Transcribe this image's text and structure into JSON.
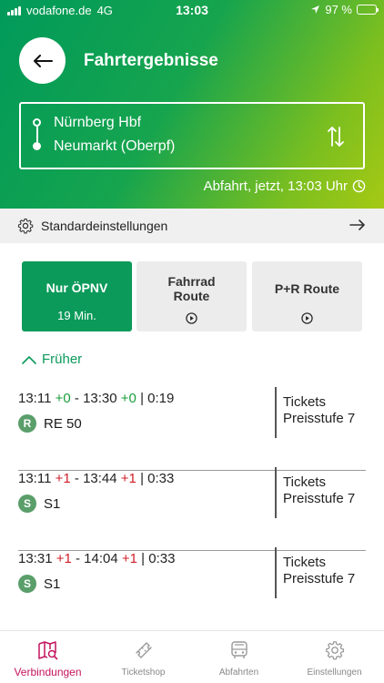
{
  "status_bar": {
    "carrier": "vodafone.de",
    "network": "4G",
    "time": "13:03",
    "battery": "97 %"
  },
  "header": {
    "title": "Fahrtergebnisse",
    "from": "Nürnberg Hbf",
    "to": "Neumarkt (Oberpf)",
    "departure": "Abfahrt, jetzt, 13:03 Uhr"
  },
  "settings": {
    "label": "Standardeinstellungen"
  },
  "options": [
    {
      "title": "Nur ÖPNV",
      "sub": "19 Min."
    },
    {
      "title_line1": "Fahrrad",
      "title_line2": "Route"
    },
    {
      "title": "P+R Route"
    }
  ],
  "earlier": "Früher",
  "connections": [
    {
      "dep": "13:11",
      "dep_delay": "+0",
      "sep": " - ",
      "arr": "13:30",
      "arr_delay": "+0",
      "duration": "| 0:19",
      "badge": "R",
      "line": "RE 50",
      "tickets": "Tickets",
      "price": "Preisstufe 7"
    },
    {
      "dep": "13:11",
      "dep_delay": "+1",
      "sep": " - ",
      "arr": "13:44",
      "arr_delay": "+1",
      "duration": "| 0:33",
      "badge": "S",
      "line": "S1",
      "tickets": "Tickets",
      "price": "Preisstufe 7"
    },
    {
      "dep": "13:31",
      "dep_delay": "+1",
      "sep": " - ",
      "arr": "14:04",
      "arr_delay": "+1",
      "duration": "| 0:33",
      "badge": "S",
      "line": "S1",
      "tickets": "Tickets",
      "price": "Preisstufe 7"
    }
  ],
  "tabs": [
    {
      "label": "Verbindungen",
      "icon": "map-search-icon"
    },
    {
      "label": "Ticketshop",
      "icon": "ticket-icon"
    },
    {
      "label": "Abfahrten",
      "icon": "bus-icon"
    },
    {
      "label": "Einstellungen",
      "icon": "gear-icon"
    }
  ],
  "colors": {
    "primary_green": "#0b9a5a",
    "header_gradient_end": "#a6c914",
    "delay_ok": "#1a9e3a",
    "delay_late": "#d0202a",
    "active_tab": "#c4135e"
  }
}
